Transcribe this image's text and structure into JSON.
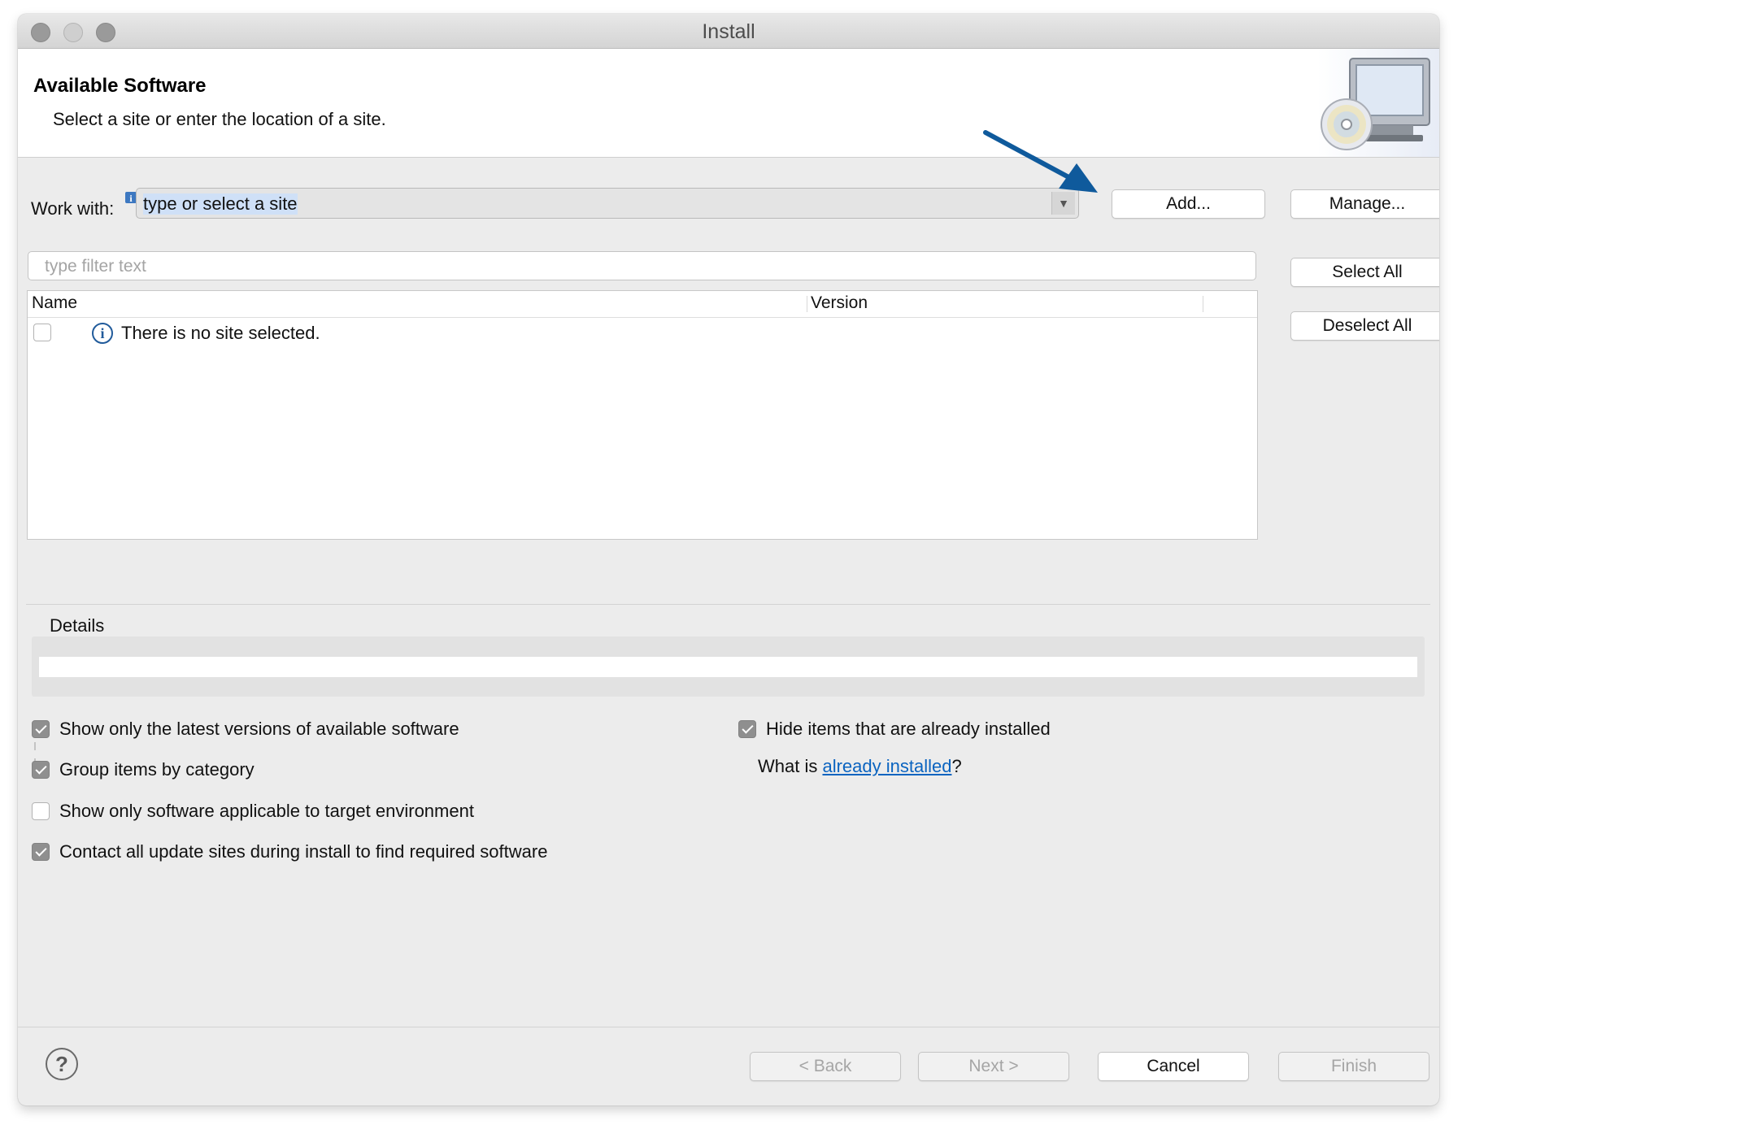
{
  "window": {
    "title": "Install"
  },
  "header": {
    "title": "Available Software",
    "description": "Select a site or enter the location of a site.",
    "banner_icon": "install-computer-cd-icon"
  },
  "work_with": {
    "label": "Work with:",
    "value": "type or select a site",
    "add_label": "Add...",
    "manage_label": "Manage..."
  },
  "filter": {
    "placeholder": "type filter text"
  },
  "side_buttons": {
    "select_all": "Select All",
    "deselect_all": "Deselect All"
  },
  "table": {
    "columns": [
      "Name",
      "Version"
    ],
    "rows": [
      {
        "checked": false,
        "icon": "info-icon",
        "text": "There is no site selected."
      }
    ]
  },
  "details": {
    "label": "Details",
    "value": ""
  },
  "options": {
    "latest_versions": {
      "label": "Show only the latest versions of available software",
      "checked": true
    },
    "group_by_category": {
      "label": "Group items by category",
      "checked": true
    },
    "target_env": {
      "label": "Show only software applicable to target environment",
      "checked": false
    },
    "contact_sites": {
      "label": "Contact all update sites during install to find required software",
      "checked": true
    },
    "hide_installed": {
      "label": "Hide items that are already installed",
      "checked": true
    },
    "what_is_prefix": "What is ",
    "what_is_link": "already installed",
    "what_is_suffix": "?"
  },
  "footer": {
    "back": "< Back",
    "next": "Next >",
    "cancel": "Cancel",
    "finish": "Finish",
    "back_enabled": false,
    "next_enabled": false,
    "finish_enabled": false
  },
  "annotation": {
    "arrow_color": "#0f5a9c",
    "points_to": "add-button"
  }
}
